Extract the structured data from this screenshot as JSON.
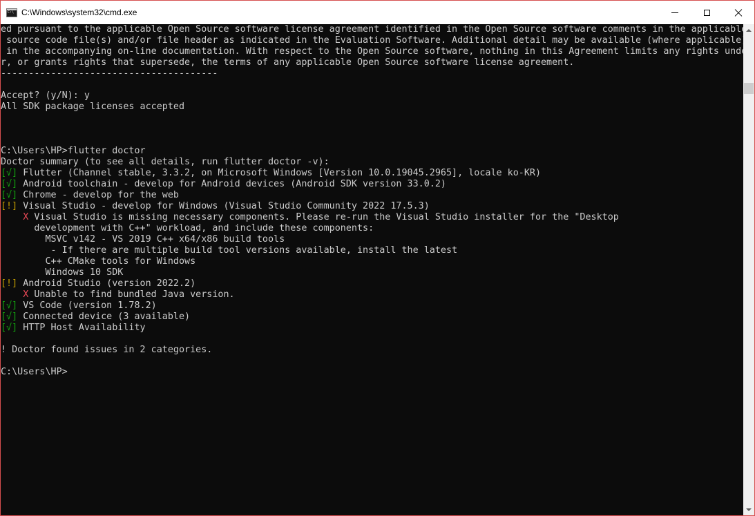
{
  "window": {
    "title": "C:\\Windows\\system32\\cmd.exe",
    "icon": "cmd-icon"
  },
  "controls": {
    "minimize": "minimize-icon",
    "maximize": "maximize-icon",
    "close": "close-icon"
  },
  "colors": {
    "background": "#0c0c0c",
    "text": "#cccccc",
    "ok": "#13a10e",
    "warn": "#c19c00",
    "error": "#e74856"
  },
  "console": {
    "lines": [
      [
        {
          "t": "ed pursuant to the applicable Open Source software license agreement identified in the Open Source software comments in the applicable"
        }
      ],
      [
        {
          "t": " source code file(s) and/or file header as indicated in the Evaluation Software. Additional detail may be available (where applicable)"
        }
      ],
      [
        {
          "t": " in the accompanying on-line documentation. With respect to the Open Source software, nothing in this Agreement limits any rights unde"
        }
      ],
      [
        {
          "t": "r, or grants rights that supersede, the terms of any applicable Open Source software license agreement."
        }
      ],
      [
        {
          "t": "---------------------------------------"
        }
      ],
      [
        {
          "t": ""
        }
      ],
      [
        {
          "t": "Accept? (y/N): y"
        }
      ],
      [
        {
          "t": "All SDK package licenses accepted"
        }
      ],
      [
        {
          "t": ""
        }
      ],
      [
        {
          "t": ""
        }
      ],
      [
        {
          "t": ""
        }
      ],
      [
        {
          "t": "C:\\Users\\HP>flutter doctor"
        }
      ],
      [
        {
          "t": "Doctor summary (to see all details, run flutter doctor -v):"
        }
      ],
      [
        {
          "t": "[√]",
          "c": "g"
        },
        {
          "t": " Flutter (Channel stable, 3.3.2, on Microsoft Windows [Version 10.0.19045.2965], locale ko-KR)"
        }
      ],
      [
        {
          "t": "[√]",
          "c": "g"
        },
        {
          "t": " Android toolchain - develop for Android devices (Android SDK version 33.0.2)"
        }
      ],
      [
        {
          "t": "[√]",
          "c": "g"
        },
        {
          "t": " Chrome - develop for the web"
        }
      ],
      [
        {
          "t": "[!]",
          "c": "y"
        },
        {
          "t": " Visual Studio - develop for Windows (Visual Studio Community 2022 17.5.3)"
        }
      ],
      [
        {
          "t": "    "
        },
        {
          "t": "X",
          "c": "r"
        },
        {
          "t": " Visual Studio is missing necessary components. Please re-run the Visual Studio installer for the \"Desktop"
        }
      ],
      [
        {
          "t": "      development with C++\" workload, and include these components:"
        }
      ],
      [
        {
          "t": "        MSVC v142 - VS 2019 C++ x64/x86 build tools"
        }
      ],
      [
        {
          "t": "         - If there are multiple build tool versions available, install the latest"
        }
      ],
      [
        {
          "t": "        C++ CMake tools for Windows"
        }
      ],
      [
        {
          "t": "        Windows 10 SDK"
        }
      ],
      [
        {
          "t": "[!]",
          "c": "y"
        },
        {
          "t": " Android Studio (version 2022.2)"
        }
      ],
      [
        {
          "t": "    "
        },
        {
          "t": "X",
          "c": "r"
        },
        {
          "t": " Unable to find bundled Java version."
        }
      ],
      [
        {
          "t": "[√]",
          "c": "g"
        },
        {
          "t": " VS Code (version 1.78.2)"
        }
      ],
      [
        {
          "t": "[√]",
          "c": "g"
        },
        {
          "t": " Connected device (3 available)"
        }
      ],
      [
        {
          "t": "[√]",
          "c": "g"
        },
        {
          "t": " HTTP Host Availability"
        }
      ],
      [
        {
          "t": ""
        }
      ],
      [
        {
          "t": "! Doctor found issues in 2 categories."
        }
      ],
      [
        {
          "t": ""
        }
      ],
      [
        {
          "t": "C:\\Users\\HP>"
        }
      ]
    ]
  }
}
